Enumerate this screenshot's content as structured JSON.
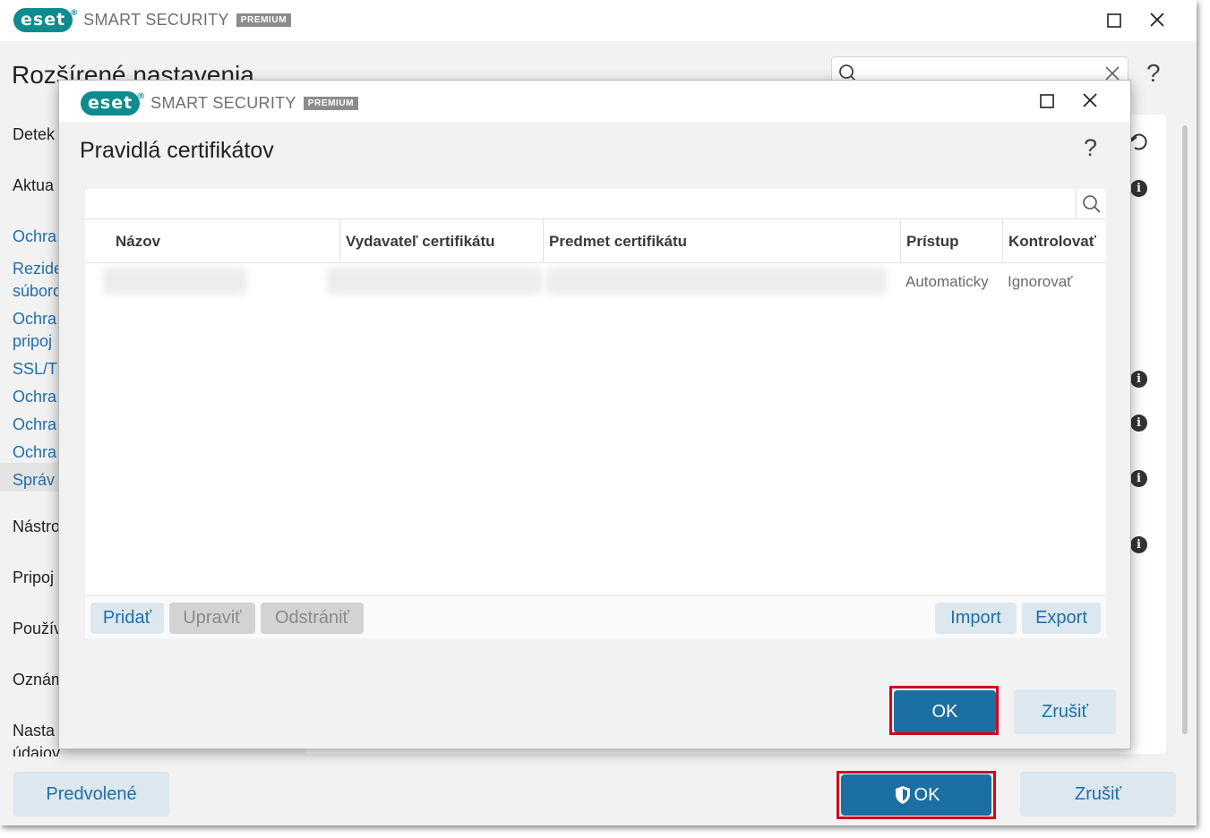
{
  "main": {
    "brand": {
      "logo_text": "eset",
      "product_name": "SMART SECURITY",
      "edition_badge": "PREMIUM"
    },
    "window_controls": {
      "maximize": "☐",
      "close": "✕"
    },
    "page_title": "Rozšírené nastavenia",
    "help_label": "?",
    "sidebar": [
      {
        "label": "Detek",
        "kind": "cat"
      },
      {
        "label": "Aktua",
        "kind": "cat"
      },
      {
        "label": "Ochra",
        "kind": "sub"
      },
      {
        "label": "Rezide",
        "kind": "sub"
      },
      {
        "label": "súboro",
        "kind": "sub"
      },
      {
        "label": "Ochra",
        "kind": "sub"
      },
      {
        "label": "pripoj",
        "kind": "sub"
      },
      {
        "label": "SSL/TL",
        "kind": "sub",
        "selected": true
      },
      {
        "label": "Ochra",
        "kind": "sub"
      },
      {
        "label": "Ochra",
        "kind": "sub"
      },
      {
        "label": "Ochra",
        "kind": "sub"
      },
      {
        "label": "Správ",
        "kind": "sub"
      },
      {
        "label": "Nástro",
        "kind": "cat"
      },
      {
        "label": "Pripoj",
        "kind": "cat"
      },
      {
        "label": "Použív",
        "kind": "cat"
      },
      {
        "label": "Oznám",
        "kind": "cat"
      },
      {
        "label": "Nasta",
        "kind": "cat"
      },
      {
        "label": "údajov",
        "kind": "cat"
      }
    ],
    "footer": {
      "default_button": "Predvolené",
      "ok_button": "OK",
      "cancel_button": "Zrušiť"
    }
  },
  "dialog": {
    "brand": {
      "logo_text": "eset",
      "product_name": "SMART SECURITY",
      "edition_badge": "PREMIUM"
    },
    "title": "Pravidlá certifikátov",
    "help_label": "?",
    "table": {
      "columns": [
        "Názov",
        "Vydavateľ certifikátu",
        "Predmet certifikátu",
        "Prístup",
        "Kontrolovať"
      ],
      "rows": [
        {
          "name": "",
          "issuer": "",
          "subject": "",
          "access": "Automaticky",
          "scan": "Ignorovať"
        }
      ]
    },
    "table_buttons": {
      "add": "Pridať",
      "edit": "Upraviť",
      "delete": "Odstrániť",
      "import": "Import",
      "export": "Export"
    },
    "ok_button": "OK",
    "cancel_button": "Zrušiť"
  },
  "colors": {
    "accent": "#1b6fa3",
    "brand": "#0d8b8f",
    "highlight_frame": "#d0021b",
    "link": "#1f6fa8"
  }
}
